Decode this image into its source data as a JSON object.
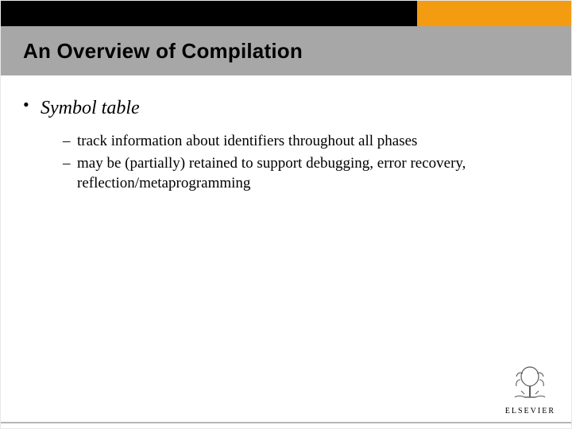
{
  "title": "An Overview of Compilation",
  "bullets": [
    {
      "label": "Symbol table",
      "sub": [
        "track information about identifiers throughout all phases",
        "may be (partially) retained to support debugging, error recovery, reflection/metaprogramming"
      ]
    }
  ],
  "publisher": {
    "name": "ELSEVIER"
  },
  "colors": {
    "orange": "#f39c12",
    "gray_bar": "#a7a7a7"
  }
}
